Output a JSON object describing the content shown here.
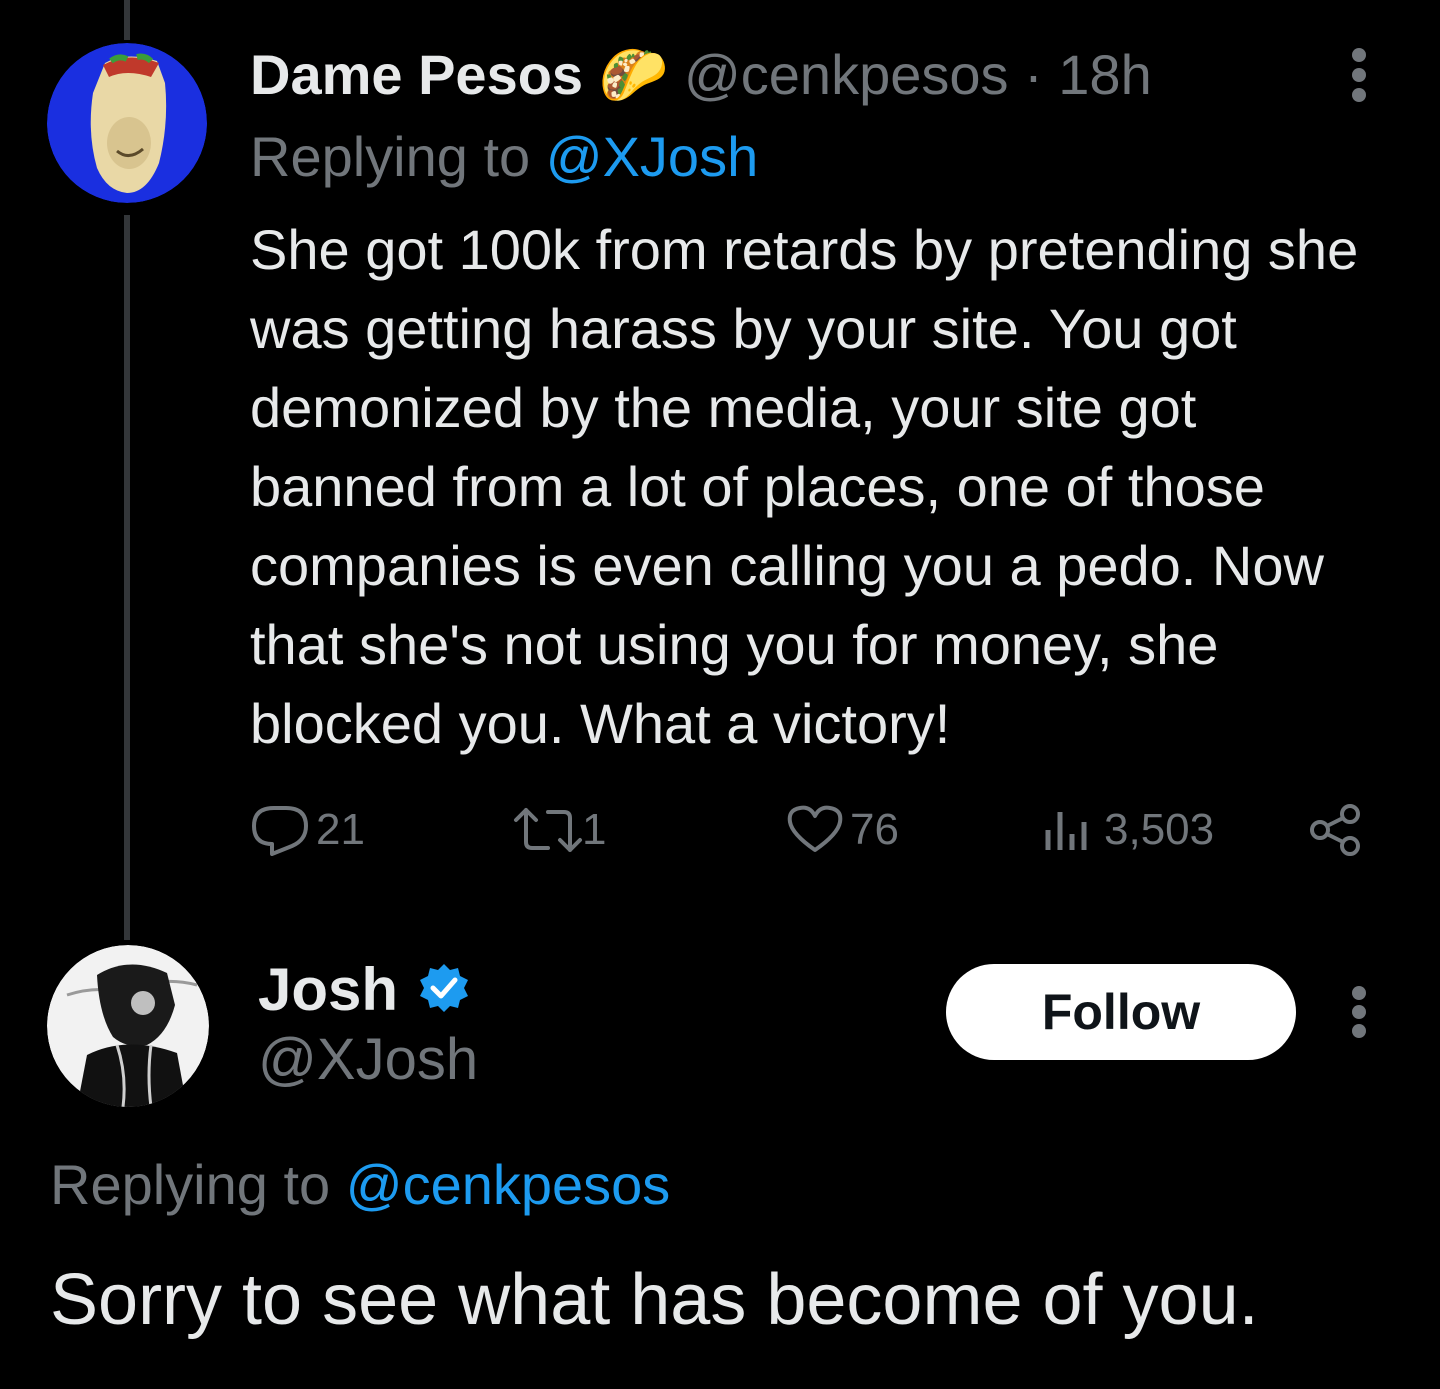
{
  "tweet1": {
    "display_name": "Dame Pesos",
    "name_emoji": "🌮",
    "handle": "@cenkpesos",
    "separator": " · ",
    "time": "18h",
    "replying_prefix": "Replying to ",
    "replying_handle": "@XJosh",
    "text": "She got 100k from retards by pretending she was getting harass by your site. You got demonized by the media, your site got banned from a lot of places, one of those companies is even calling you a pedo. Now that she's not using you for money, she blocked you. What a victory!",
    "stats": {
      "replies": "21",
      "reposts": "1",
      "likes": "76",
      "views": "3,503"
    },
    "icons": [
      "more-icon",
      "reply-icon",
      "repost-icon",
      "like-icon",
      "views-icon",
      "share-icon"
    ]
  },
  "tweet2": {
    "display_name": "Josh",
    "verified": true,
    "handle": "@XJosh",
    "follow_label": "Follow",
    "replying_prefix": "Replying to ",
    "replying_handle": "@cenkpesos",
    "text": "Sorry to see what has become of you."
  },
  "colors": {
    "background": "#000000",
    "text": "#e7e9ea",
    "muted": "#71767b",
    "link": "#1d9bf0",
    "thread_line": "#333639",
    "follow_bg": "#ffffff",
    "verified": "#1d9bf0",
    "avatar1_bg": "#1a2fe0"
  }
}
